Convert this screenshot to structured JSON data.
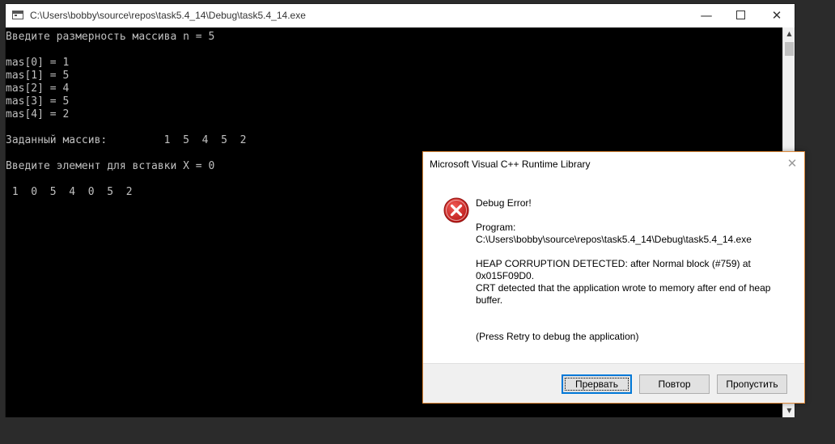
{
  "console": {
    "title": "C:\\Users\\bobby\\source\\repos\\task5.4_14\\Debug\\task5.4_14.exe",
    "minimize_glyph": "—",
    "close_glyph": "✕",
    "output": "Введите размерность массива n = 5\n\nmas[0] = 1\nmas[1] = 5\nmas[2] = 4\nmas[3] = 5\nmas[4] = 2\n\nЗаданный массив:         1  5  4  5  2\n\nВведите элемент для вставки X = 0\n\n 1  0  5  4  0  5  2",
    "colors": {
      "background": "#000000",
      "text": "#c0c0c0"
    }
  },
  "dialog": {
    "title": "Microsoft Visual C++ Runtime Library",
    "close_glyph": "✕",
    "icon": "error-icon",
    "heading": "Debug Error!",
    "program_label": "Program:",
    "program_path": "C:\\Users\\bobby\\source\\repos\\task5.4_14\\Debug\\task5.4_14.exe",
    "error_line1": "HEAP CORRUPTION DETECTED: after Normal block (#759) at",
    "error_line2": "0x015F09D0.",
    "error_line3": "CRT detected that the application wrote to memory after end of heap",
    "error_line4": "buffer.",
    "hint": "(Press Retry to debug the application)",
    "buttons": {
      "abort": "Прервать",
      "retry": "Повтор",
      "ignore": "Пропустить"
    },
    "colors": {
      "error_red": "#d9201f",
      "border": "#e08a3a",
      "focus": "#0078d7"
    }
  }
}
